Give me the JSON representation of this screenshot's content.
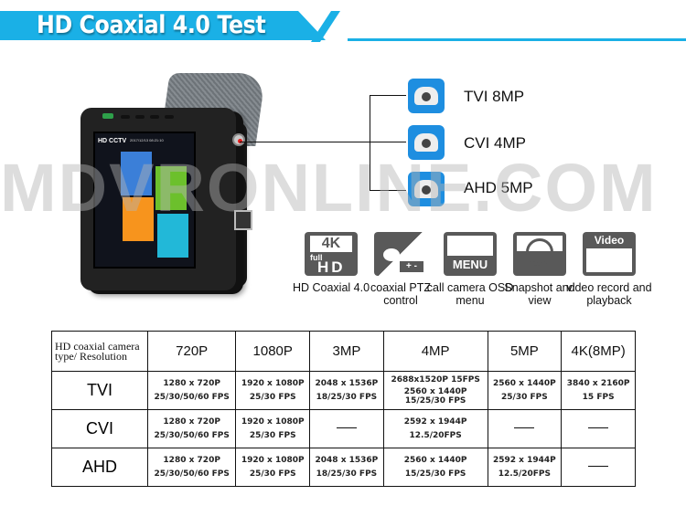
{
  "header": {
    "title": "HD Coaxial 4.0 Test",
    "accent_color": "#1ab0e6"
  },
  "watermark": "MDVRONLINE.COM",
  "device": {
    "screen_title": "HD CCTV",
    "screen_time": "2017/12/13 08:21:10"
  },
  "cameras": [
    {
      "icon": "bullet-camera-icon",
      "label": "TVI 8MP"
    },
    {
      "icon": "dome-camera-icon",
      "label": "CVI 4MP"
    },
    {
      "icon": "dome-camera-icon",
      "label": "AHD 5MP"
    }
  ],
  "features": [
    {
      "icon": "4k-full-hd-icon",
      "icon_text": [
        "4K",
        "full",
        "HD"
      ],
      "label": "HD Coaxial 4.0"
    },
    {
      "icon": "ptz-camera-icon",
      "icon_text": [
        "+ -"
      ],
      "label": "coaxial PTZ control"
    },
    {
      "icon": "menu-icon",
      "icon_text": [
        "MENU"
      ],
      "label": "call camera OSD menu"
    },
    {
      "icon": "camera-icon",
      "icon_text": [],
      "label": "Snapshot and view"
    },
    {
      "icon": "video-icon",
      "icon_text": [
        "Video"
      ],
      "label": "video record and playback"
    }
  ],
  "table": {
    "corner": "HD coaxial camera type/ Resolution",
    "columns": [
      "720P",
      "1080P",
      "3MP",
      "4MP",
      "5MP",
      "4K(8MP)"
    ],
    "rows": [
      {
        "type": "TVI",
        "cells": [
          [
            "1280 x 720P",
            "25/30/50/60 FPS"
          ],
          [
            "1920 x 1080P",
            "25/30 FPS"
          ],
          [
            "2048 x 1536P",
            "18/25/30 FPS"
          ],
          [
            "2688x1520P 15FPS",
            "2560 x 1440P",
            "15/25/30 FPS"
          ],
          [
            "2560 x 1440P",
            "25/30 FPS"
          ],
          [
            "3840 x 2160P",
            "15 FPS"
          ]
        ]
      },
      {
        "type": "CVI",
        "cells": [
          [
            "1280 x 720P",
            "25/30/50/60 FPS"
          ],
          [
            "1920 x 1080P",
            "25/30 FPS"
          ],
          [
            "—"
          ],
          [
            "2592 x 1944P",
            "12.5/20FPS"
          ],
          [
            "—"
          ],
          [
            "—"
          ]
        ]
      },
      {
        "type": "AHD",
        "cells": [
          [
            "1280 x 720P",
            "25/30/50/60 FPS"
          ],
          [
            "1920 x 1080P",
            "25/30 FPS"
          ],
          [
            "2048 x 1536P",
            "18/25/30 FPS"
          ],
          [
            "2560 x 1440P",
            "15/25/30 FPS"
          ],
          [
            "2592 x 1944P",
            "12.5/20FPS"
          ],
          [
            "—"
          ]
        ]
      }
    ]
  }
}
